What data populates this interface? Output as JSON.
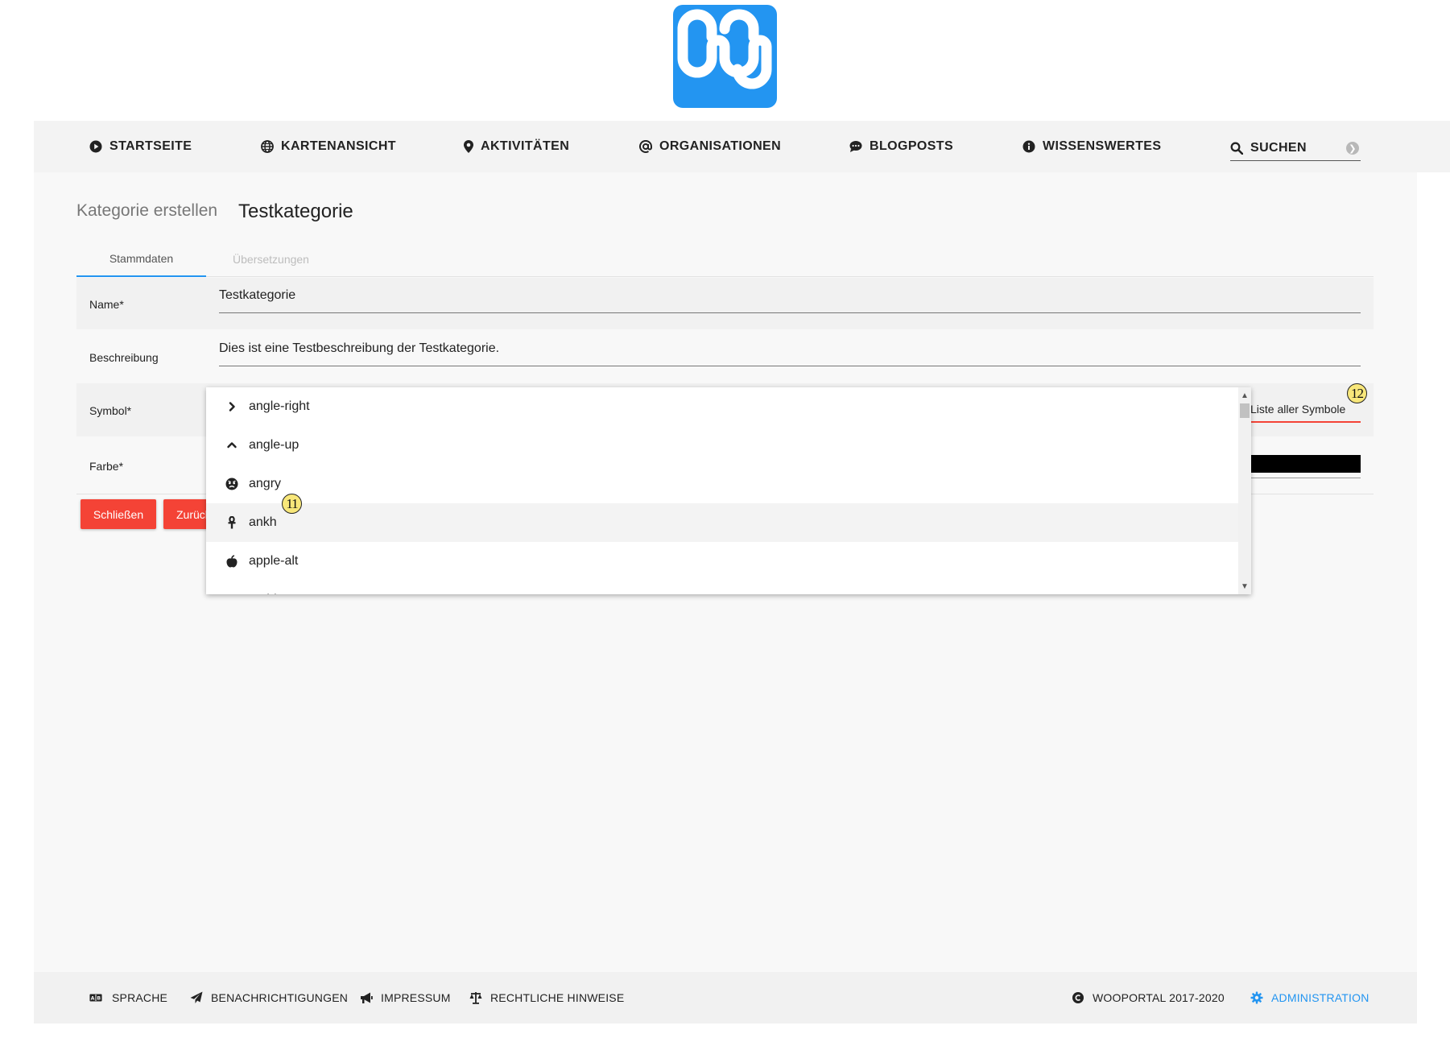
{
  "logo": {
    "alt": "wooportal",
    "bg_color": "#2395f1"
  },
  "nav": {
    "items": [
      {
        "label": "STARTSEITE",
        "icon": "play-circle-icon"
      },
      {
        "label": "KARTENANSICHT",
        "icon": "globe-icon"
      },
      {
        "label": "AKTIVITÄTEN",
        "icon": "map-marker-icon"
      },
      {
        "label": "ORGANISATIONEN",
        "icon": "at-icon"
      },
      {
        "label": "BLOGPOSTS",
        "icon": "comment-dots-icon"
      },
      {
        "label": "WISSENSWERTES",
        "icon": "info-circle-icon"
      }
    ],
    "search_label": "SUCHEN"
  },
  "header": {
    "breadcrumb": "Kategorie erstellen",
    "title": "Testkategorie"
  },
  "tabs": [
    {
      "label": "Stammdaten",
      "active": true
    },
    {
      "label": "Übersetzungen",
      "active": false
    }
  ],
  "form": {
    "name_label": "Name*",
    "name_value": "Testkategorie",
    "description_label": "Beschreibung",
    "description_value": "Dies ist eine Testbeschreibung der Testkategorie.",
    "symbol_label": "Symbol*",
    "symbol_link": "Liste aller Symbole",
    "color_label": "Farbe*",
    "color_value": "#000000"
  },
  "buttons": {
    "close": "Schließen",
    "back": "Zurück"
  },
  "symbol_dropdown": {
    "items": [
      {
        "label": "angle-right",
        "icon": "angle-right-icon"
      },
      {
        "label": "angle-up",
        "icon": "angle-up-icon"
      },
      {
        "label": "angry",
        "icon": "angry-icon"
      },
      {
        "label": "ankh",
        "icon": "ankh-icon",
        "highlighted": true
      },
      {
        "label": "apple-alt",
        "icon": "apple-alt-icon"
      },
      {
        "label": "archive",
        "icon": "archive-icon"
      }
    ]
  },
  "markers": {
    "ankh": "11",
    "symbol_link": "12"
  },
  "footer": {
    "language": "SPRACHE",
    "notifications": "BENACHRICHTIGUNGEN",
    "imprint": "IMPRESSUM",
    "legal": "RECHTLICHE HINWEISE",
    "copyright": "WOOPORTAL 2017-2020",
    "admin": "ADMINISTRATION"
  },
  "colors": {
    "accent": "#2395f1",
    "button": "#f44336",
    "nav_bg": "#f3f3f3",
    "content_bg": "#f8f8f8"
  }
}
